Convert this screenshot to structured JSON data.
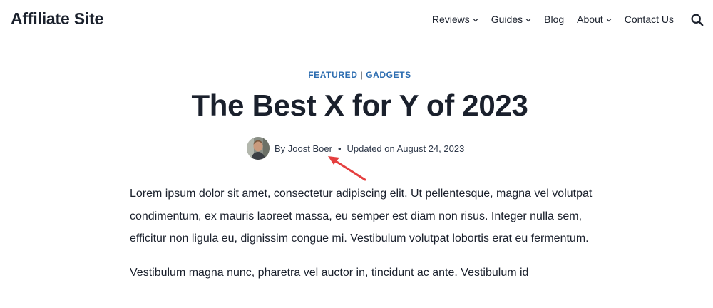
{
  "header": {
    "site_title": "Affiliate Site",
    "nav": [
      {
        "label": "Reviews",
        "has_dropdown": true
      },
      {
        "label": "Guides",
        "has_dropdown": true
      },
      {
        "label": "Blog",
        "has_dropdown": false
      },
      {
        "label": "About",
        "has_dropdown": true
      },
      {
        "label": "Contact Us",
        "has_dropdown": false
      }
    ],
    "search_icon": "search-icon"
  },
  "article": {
    "categories": [
      "FEATURED",
      "GADGETS"
    ],
    "category_separator": "|",
    "title": "The Best X for Y of 2023",
    "meta": {
      "by_prefix": "By",
      "author": "Joost Boer",
      "bullet": "•",
      "updated": "Updated on August 24, 2023"
    },
    "paragraphs": [
      "Lorem ipsum dolor sit amet, consectetur adipiscing elit. Ut pellentesque, magna vel volutpat condimentum, ex mauris laoreet massa, eu semper est diam non risus. Integer nulla sem, efficitur non ligula eu, dignissim congue mi. Vestibulum volutpat lobortis erat eu fermentum.",
      "Vestibulum magna nunc, pharetra vel auctor in, tincidunt ac ante. Vestibulum id"
    ]
  },
  "colors": {
    "accent": "#2b6cb0",
    "text": "#1a202c",
    "annotation_arrow": "#e53e3e"
  }
}
